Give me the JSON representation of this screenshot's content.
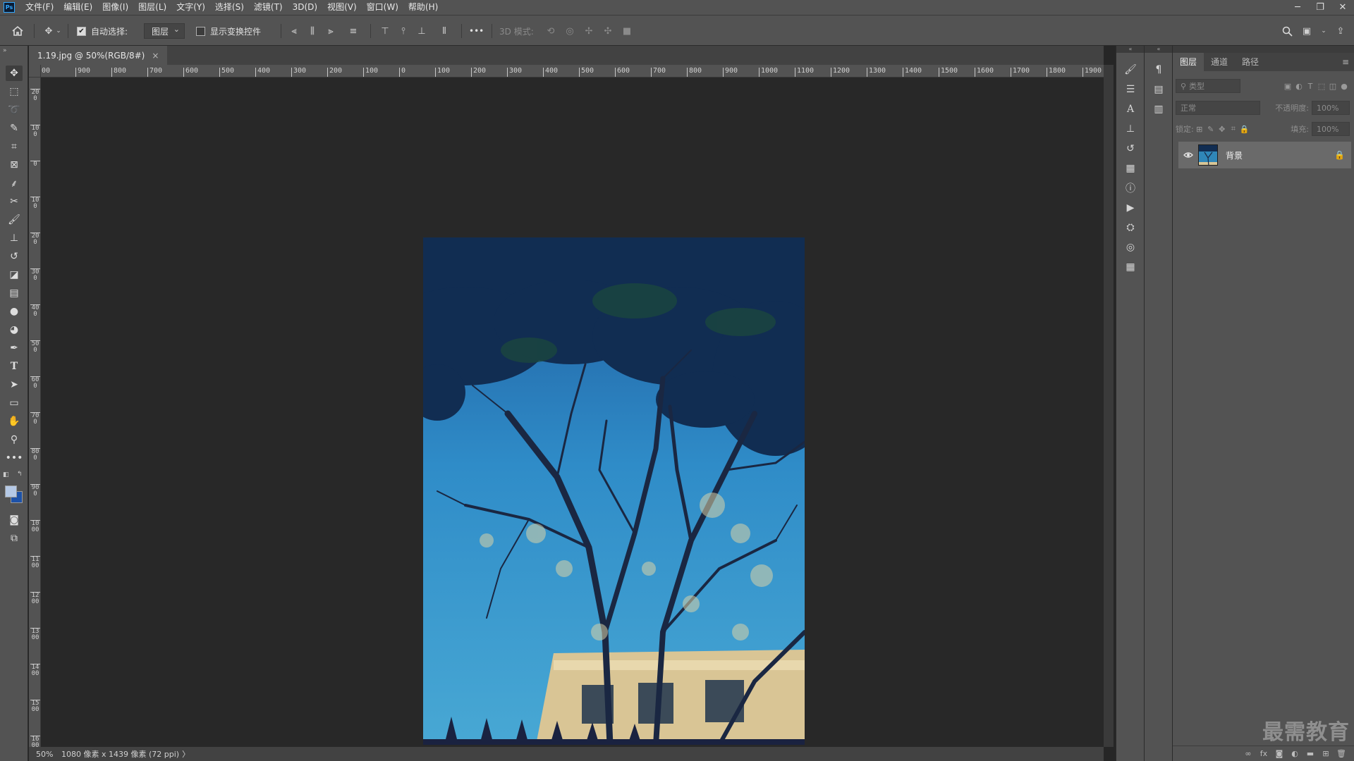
{
  "app": {
    "logo": "Ps"
  },
  "menu": [
    "文件(F)",
    "编辑(E)",
    "图像(I)",
    "图层(L)",
    "文字(Y)",
    "选择(S)",
    "滤镜(T)",
    "3D(D)",
    "视图(V)",
    "窗口(W)",
    "帮助(H)"
  ],
  "window_controls": {
    "minimize": "─",
    "restore": "❐",
    "close": "✕"
  },
  "options": {
    "auto_select_label": "自动选择:",
    "auto_select_checked": true,
    "auto_select_target": "图层",
    "show_transform_label": "显示变换控件",
    "show_transform_checked": false,
    "more": "•••",
    "mode_3d_label": "3D 模式:"
  },
  "document": {
    "tab_title": "1.19.jpg @ 50%(RGB/8#)",
    "tab_close": "×"
  },
  "rulers": {
    "h_ticks": [
      "00",
      "900",
      "800",
      "700",
      "600",
      "500",
      "400",
      "300",
      "200",
      "100",
      "0",
      "100",
      "200",
      "300",
      "400",
      "500",
      "600",
      "700",
      "800",
      "900",
      "1000",
      "1100",
      "1200",
      "1300",
      "1400",
      "1500",
      "1600",
      "1700",
      "1800",
      "1900",
      "200"
    ],
    "v_ticks": [
      "200",
      "100",
      "0",
      "100",
      "200",
      "300",
      "400",
      "500",
      "600",
      "700",
      "800",
      "900",
      "1000",
      "1100",
      "1200",
      "1300",
      "1400",
      "1500",
      "1600"
    ]
  },
  "status": {
    "zoom": "50%",
    "info": "1080 像素 x 1439 像素 (72 ppi)",
    "arrow": "〉"
  },
  "layers_panel": {
    "tabs": [
      "图层",
      "通道",
      "路径"
    ],
    "active_tab": 0,
    "filter_placeholder": "类型",
    "blend_mode": "正常",
    "opacity_label": "不透明度:",
    "opacity_value": "100%",
    "lock_label": "锁定:",
    "fill_label": "填充:",
    "fill_value": "100%",
    "layers": [
      {
        "name": "背景",
        "visible": true,
        "locked": true
      }
    ]
  },
  "watermark": "最需教育",
  "colors": {
    "ui_bg": "#535353",
    "canvas_bg": "#282828",
    "foreground_swatch": "#b5c9e6",
    "background_swatch": "#1d52a8"
  }
}
